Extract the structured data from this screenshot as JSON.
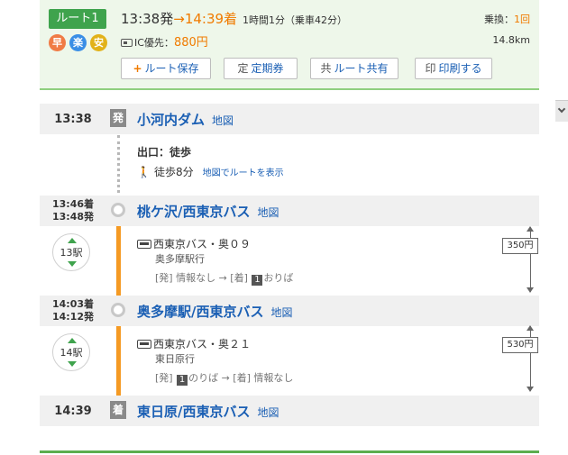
{
  "header": {
    "route_label": "ルート1",
    "features": [
      "早",
      "楽",
      "安"
    ],
    "dep_time": "13:38発",
    "arrow": "→",
    "arr_time": "14:39着",
    "duration": "1時間1分（乗車42分）",
    "ic_label": "IC優先：",
    "fare": "880円",
    "transfer_label": "乗換：",
    "transfer_count": "1回",
    "distance": "14.8km",
    "buttons": [
      {
        "icon": "+",
        "label": "ルート保存"
      },
      {
        "icon": "定",
        "label": "定期券"
      },
      {
        "icon": "共",
        "label": "ルート共有"
      },
      {
        "icon": "印",
        "label": "印刷する"
      }
    ]
  },
  "stations": [
    {
      "time": "13:38",
      "marker": "発",
      "name": "小河内ダム",
      "map": "地図"
    },
    {
      "time_arr": "13:46着",
      "time_dep": "13:48発",
      "name": "桃ケ沢/西東京バス",
      "map": "地図"
    },
    {
      "time_arr": "14:03着",
      "time_dep": "14:12発",
      "name": "奥多摩駅/西東京バス",
      "map": "地図"
    },
    {
      "time": "14:39",
      "marker": "着",
      "name": "東日原/西東京バス",
      "map": "地図"
    }
  ],
  "walk": {
    "exit": "出口：徒歩",
    "walk_time": "徒歩8分",
    "map_route_link": "地図でルートを表示"
  },
  "segments": [
    {
      "stops": "13駅",
      "line": "西東京バス・奥０９",
      "dest": "奥多摩駅行",
      "info_dep": "[発] 情報なし → [着] ",
      "info_num": "1",
      "info_tail": "おりば",
      "fare": "350円"
    },
    {
      "stops": "14駅",
      "line": "西東京バス・奥２１",
      "dest": "東日原行",
      "info_dep": "[発] ",
      "info_num": "1",
      "info_tail": "のりば → [着] 情報なし",
      "fare": "530円"
    }
  ]
}
